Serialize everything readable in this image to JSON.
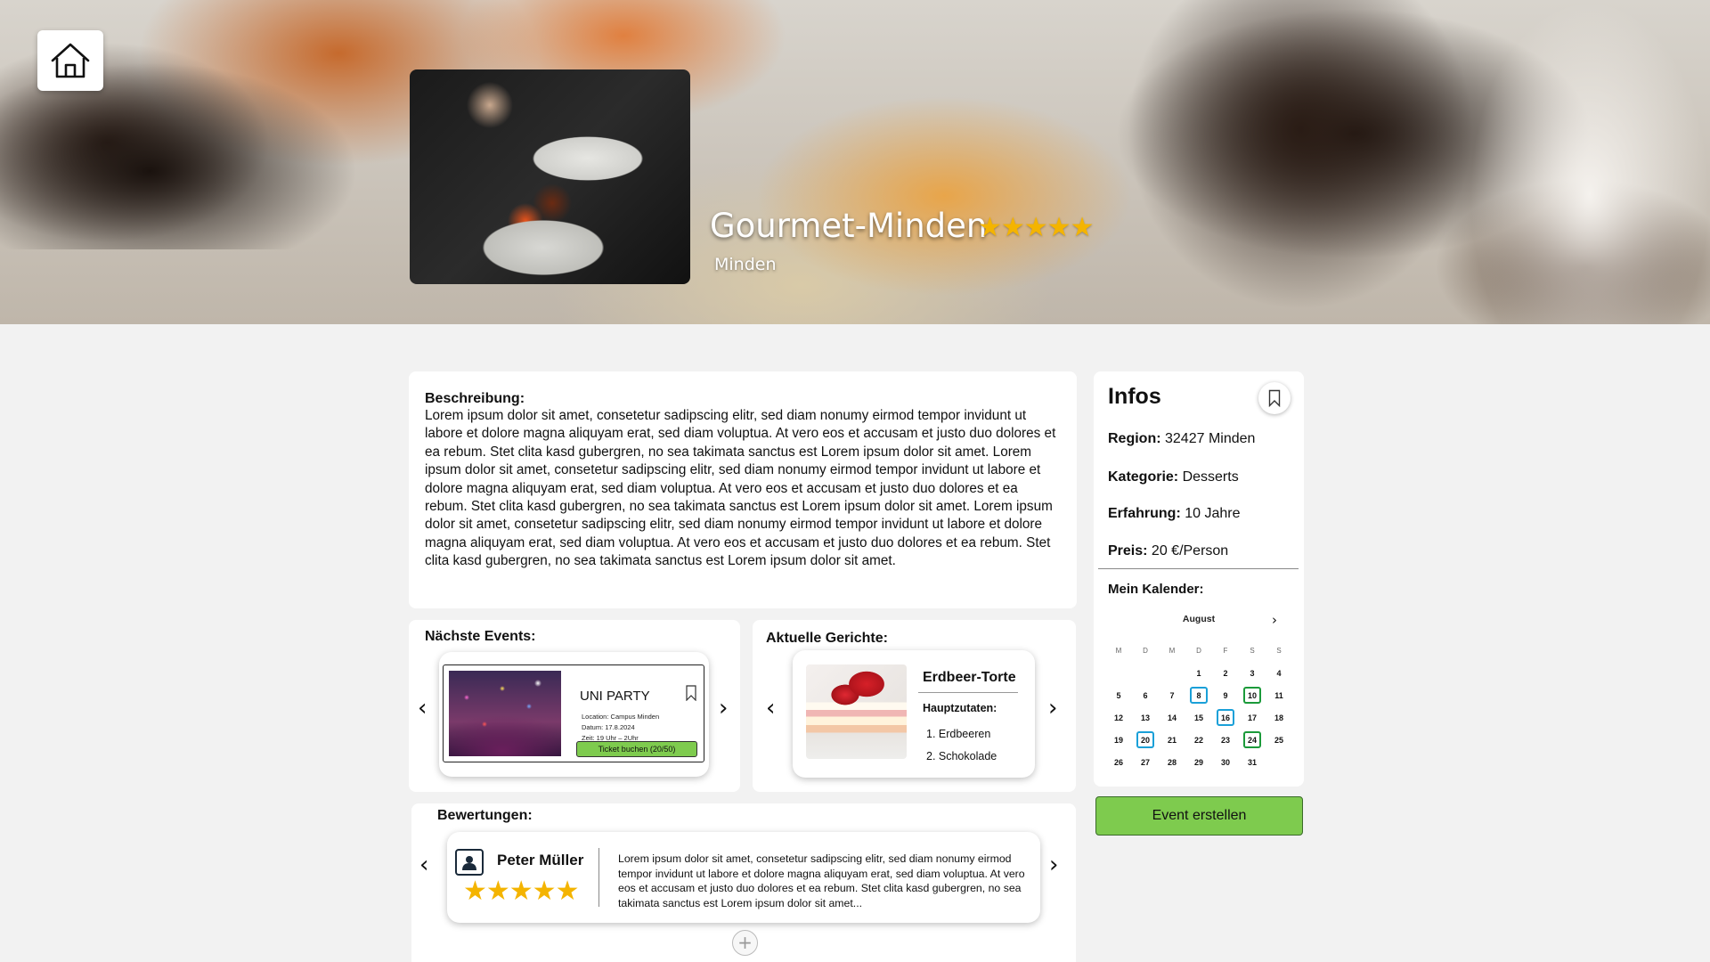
{
  "header": {
    "title": "Gourmet-Minden",
    "rating_stars": "★★★★★",
    "rating": 5,
    "city": "Minden"
  },
  "description": {
    "label": "Beschreibung:",
    "text": "Lorem ipsum dolor sit amet, consetetur sadipscing elitr, sed diam nonumy eirmod tempor invidunt ut labore et dolore magna aliquyam erat, sed diam voluptua. At vero eos et accusam et justo duo dolores et ea rebum. Stet clita kasd gubergren, no sea takimata sanctus est Lorem ipsum dolor sit amet. Lorem ipsum dolor sit amet, consetetur sadipscing elitr, sed diam nonumy eirmod tempor invidunt ut labore et dolore magna aliquyam erat, sed diam voluptua. At vero eos et accusam et justo duo dolores et ea rebum. Stet clita kasd gubergren, no sea takimata sanctus est Lorem ipsum dolor sit amet. Lorem ipsum dolor sit amet, consetetur sadipscing elitr, sed diam nonumy eirmod tempor invidunt ut labore et dolore magna aliquyam erat, sed diam voluptua. At vero eos et accusam et justo duo dolores et ea rebum. Stet clita kasd gubergren, no sea takimata sanctus est Lorem ipsum dolor sit amet."
  },
  "events": {
    "label": "Nächste Events:",
    "item": {
      "title": "UNI PARTY",
      "location": "Location: Campus Minden",
      "date": "Datum: 17.8.2024",
      "time": "Zeit: 19 Uhr – 2Uhr",
      "button": "Ticket buchen (20/50)"
    }
  },
  "dishes": {
    "label": "Aktuelle Gerichte:",
    "item": {
      "title": "Erdbeer-Torte",
      "ingredients_label": "Hauptzutaten:",
      "ingredients": [
        "1. Erdbeeren",
        "2. Schokolade"
      ]
    }
  },
  "reviews": {
    "label": "Bewertungen:",
    "item": {
      "name": "Peter Müller",
      "stars": "★★★★★",
      "rating": 5,
      "text": "Lorem ipsum dolor sit amet, consetetur sadipscing elitr, sed diam nonumy eirmod tempor invidunt ut labore et dolore magna aliquyam erat, sed diam voluptua. At vero eos et accusam et justo duo dolores et ea rebum. Stet clita kasd gubergren, no sea takimata sanctus est Lorem ipsum dolor sit amet..."
    },
    "add_icon": "+"
  },
  "infos": {
    "title": "Infos",
    "region_label": "Region:",
    "region_value": "32427 Minden",
    "category_label": "Kategorie:",
    "category_value": "Desserts",
    "experience_label": "Erfahrung:",
    "experience_value": "10 Jahre",
    "price_label": "Preis:",
    "price_value": "20 €/Person",
    "calendar_label": "Mein Kalender:",
    "calendar": {
      "month": "August",
      "weekdays": [
        "M",
        "D",
        "M",
        "D",
        "F",
        "S",
        "S"
      ],
      "days": [
        [
          "",
          "",
          "",
          "1",
          "2",
          "3",
          "4"
        ],
        [
          "5",
          "6",
          "7",
          "8",
          "9",
          "10",
          "11"
        ],
        [
          "12",
          "13",
          "14",
          "15",
          "16",
          "17",
          "18"
        ],
        [
          "19",
          "20",
          "21",
          "22",
          "23",
          "24",
          "25"
        ],
        [
          "26",
          "27",
          "28",
          "29",
          "30",
          "31",
          ""
        ]
      ],
      "highlight_blue": [
        "8",
        "16",
        "20"
      ],
      "highlight_green": [
        "10",
        "24"
      ]
    }
  },
  "create_event_button": "Event erstellen",
  "colors": {
    "accent_green": "#7ecb4e",
    "star_yellow": "#f4b400",
    "calendar_blue": "#1aa0d8",
    "calendar_green": "#1b9a3a"
  }
}
